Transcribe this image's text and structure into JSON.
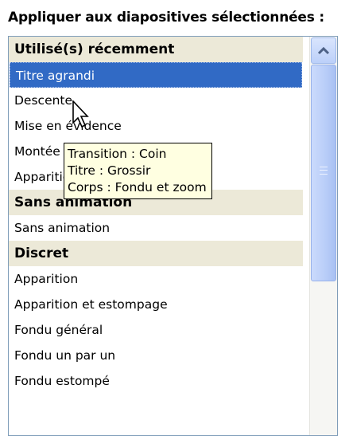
{
  "header": {
    "title": "Appliquer aux diapositives sélectionnées :"
  },
  "list": {
    "rows": [
      {
        "text": "Utilisé(s) récemment",
        "type": "group"
      },
      {
        "text": "Titre agrandi",
        "type": "selected"
      },
      {
        "text": "Descente",
        "type": "item"
      },
      {
        "text": "Mise en évidence",
        "type": "item"
      },
      {
        "text": "Montée",
        "type": "item"
      },
      {
        "text": "Apparition",
        "type": "item"
      },
      {
        "text": "Sans animation",
        "type": "group"
      },
      {
        "text": "Sans animation",
        "type": "item"
      },
      {
        "text": "Discret",
        "type": "group"
      },
      {
        "text": "Apparition",
        "type": "item"
      },
      {
        "text": "Apparition et estompage",
        "type": "item"
      },
      {
        "text": "Fondu général",
        "type": "item"
      },
      {
        "text": "Fondu un par un",
        "type": "item"
      },
      {
        "text": "Fondu estompé",
        "type": "item"
      }
    ]
  },
  "tooltip": {
    "line1": "Transition : Coin",
    "line2": "Titre : Grossir",
    "line3": "Corps : Fondu et zoom"
  },
  "scrollbar": {
    "icon": "chevron-up-icon",
    "grip_icon": "grip-icon"
  },
  "colors": {
    "selection": "#316ac5",
    "group_bg": "#ece9d8",
    "tooltip_bg": "#ffffe1"
  }
}
